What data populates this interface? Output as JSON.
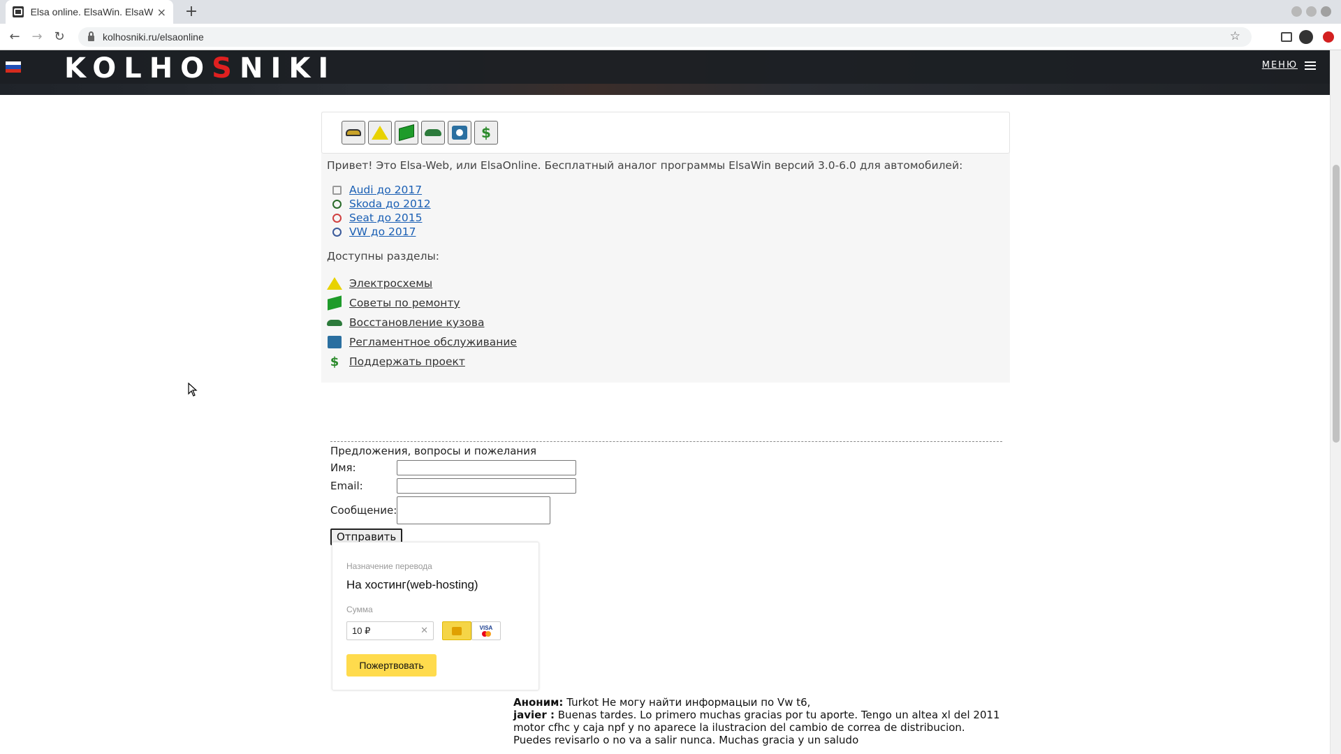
{
  "browser": {
    "tab_title": "Elsa online. ElsaWin. ElsaWeb",
    "url": "kolhosniki.ru/elsaonline"
  },
  "site": {
    "logo_parts": [
      "KOLHO",
      "S",
      "NIKI"
    ],
    "menu_label": "МЕНЮ",
    "brand_red": "#e02020"
  },
  "intro": {
    "text": "Привет! Это Elsa-Web, или ElsaOnline. Бесплатный аналог программы ElsaWin версий 3.0-6.0 для автомобилей:"
  },
  "brands": [
    {
      "label": "Audi до 2017",
      "icon": "audi-logo-icon"
    },
    {
      "label": "Skoda до 2012",
      "icon": "skoda-logo-icon"
    },
    {
      "label": "Seat до 2015",
      "icon": "seat-logo-icon"
    },
    {
      "label": "VW до 2017",
      "icon": "vw-logo-icon"
    }
  ],
  "sections": {
    "label": "Доступны разделы:",
    "items": [
      {
        "label": "Электросхемы",
        "icon": "warning-triangle-icon"
      },
      {
        "label": "Советы по ремонту",
        "icon": "green-book-icon"
      },
      {
        "label": "Восстановление кузова",
        "icon": "car-body-icon"
      },
      {
        "label": "Регламентное обслуживание",
        "icon": "service-book-icon"
      },
      {
        "label": "Поддержать проект",
        "icon": "donate-hand-icon"
      }
    ]
  },
  "form": {
    "title": "Предложения, вопросы и пожелания",
    "name_label": "Имя:",
    "email_label": "Email:",
    "message_label": "Сообщение:",
    "submit_label": "Отправить"
  },
  "donate": {
    "purpose_label": "Назначение перевода",
    "purpose_value": "На хостинг(web-hosting)",
    "amount_label": "Сумма",
    "amount_value": "10 ₽",
    "button_label": "Пожертвовать",
    "card_brand": "VISA"
  },
  "comments": [
    {
      "author": "Аноним:",
      "text": "Turkot Не могу найти информацыи по Vw t6,"
    },
    {
      "author": "javier :",
      "text": "Buenas tardes. Lo primero muchas gracias por tu aporte. Tengo un altea xl del 2011 motor cfhc y caja npf y no aparece la ilustracion del cambio de correa de distribucion. Puedes revisarlo o no va a salir nunca. Muchas gracia y un saludo"
    }
  ]
}
